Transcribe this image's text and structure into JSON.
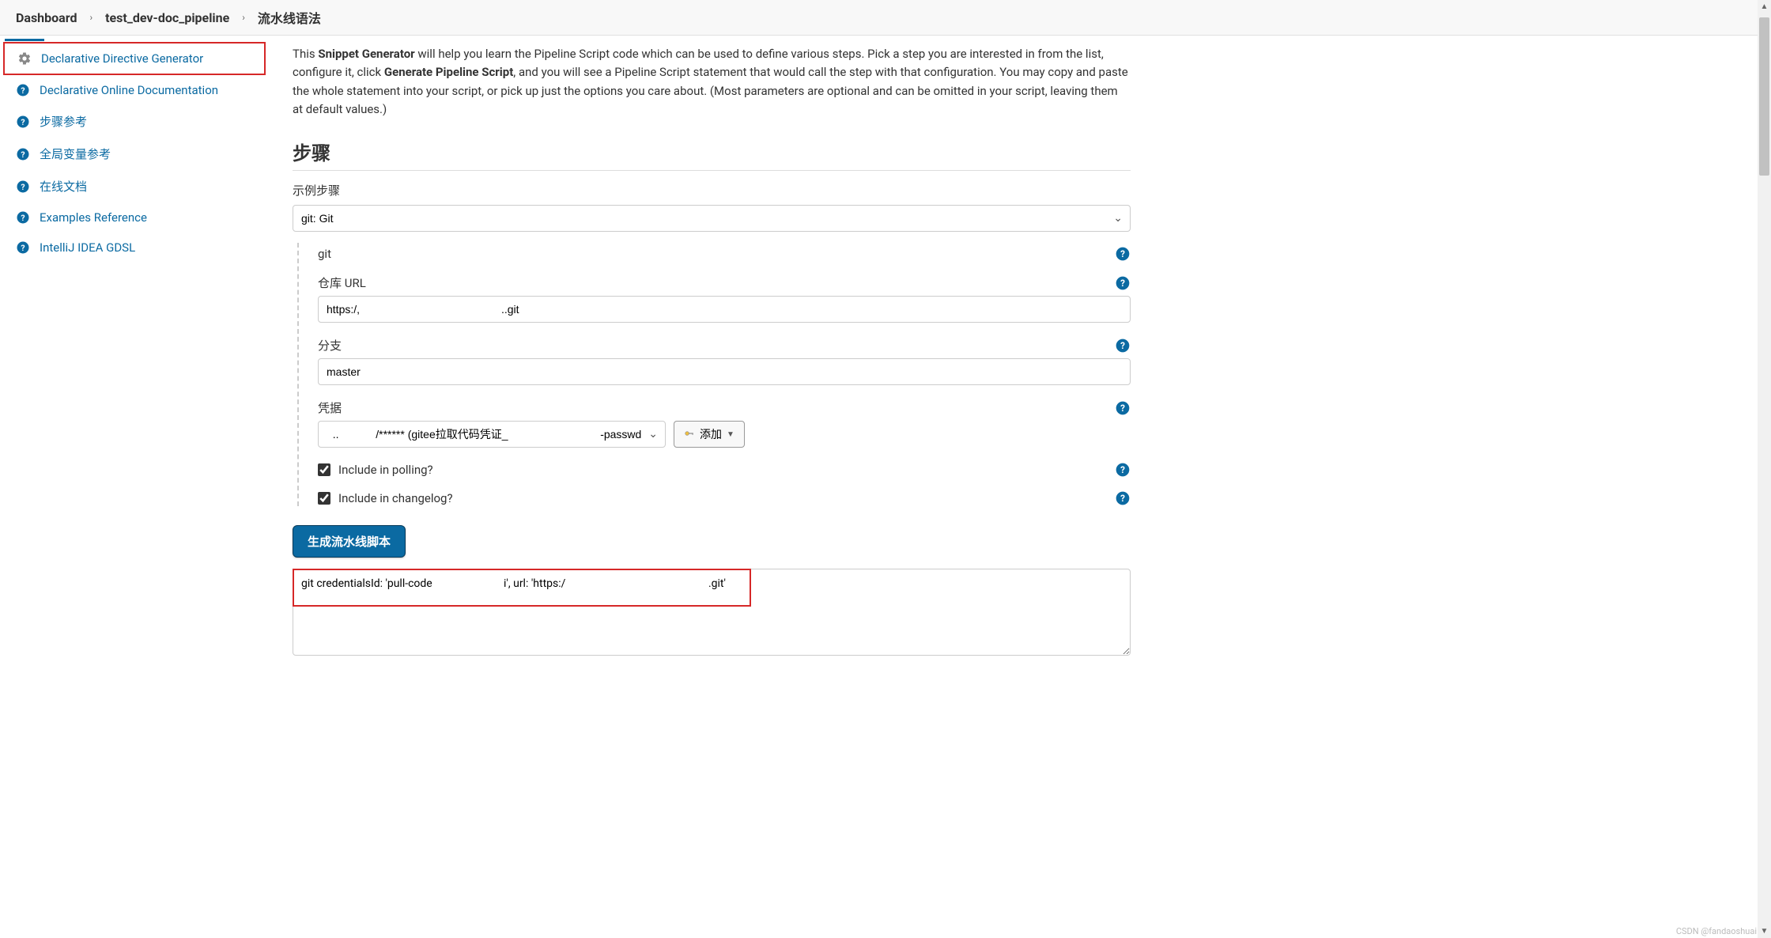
{
  "breadcrumb": {
    "items": [
      "Dashboard",
      "test_dev-doc_pipeline",
      "流水线语法"
    ]
  },
  "sidebar": {
    "items": [
      {
        "label": "Declarative Directive Generator",
        "icon": "gear",
        "highlighted": true
      },
      {
        "label": "Declarative Online Documentation",
        "icon": "help"
      },
      {
        "label": "步骤参考",
        "icon": "help"
      },
      {
        "label": "全局变量参考",
        "icon": "help"
      },
      {
        "label": "在线文档",
        "icon": "help"
      },
      {
        "label": "Examples Reference",
        "icon": "help"
      },
      {
        "label": "IntelliJ IDEA GDSL",
        "icon": "help"
      }
    ]
  },
  "intro": {
    "prefix": "This ",
    "bold1": "Snippet Generator",
    "mid1": " will help you learn the Pipeline Script code which can be used to define various steps. Pick a step you are interested in from the list, configure it, click ",
    "bold2": "Generate Pipeline Script",
    "suffix": ", and you will see a Pipeline Script statement that would call the step with that configuration. You may copy and paste the whole statement into your script, or pick up just the options you care about. (Most parameters are optional and can be omitted in your script, leaving them at default values.)"
  },
  "section": {
    "heading": "步骤",
    "example_label": "示例步骤",
    "step_selected": "git: Git"
  },
  "git_form": {
    "title": "git",
    "repo_label": "仓库 URL",
    "repo_value": "https:/,                                              ..git",
    "branch_label": "分支",
    "branch_value": "master",
    "cred_label": "凭据",
    "cred_value": "  ..            /****** (gitee拉取代码凭证_                              -passwd)",
    "add_label": "添加",
    "polling_label": "Include in polling?",
    "changelog_label": "Include in changelog?"
  },
  "generate": {
    "button_label": "生成流水线脚本",
    "output": "git credentialsId: 'pull-code                          i', url: 'https:/                                                    .git'"
  },
  "watermark": "CSDN @fandaoshuai",
  "colors": {
    "accent": "#0b6aa2",
    "highlight": "#d62828",
    "help": "#0b6aa2"
  }
}
